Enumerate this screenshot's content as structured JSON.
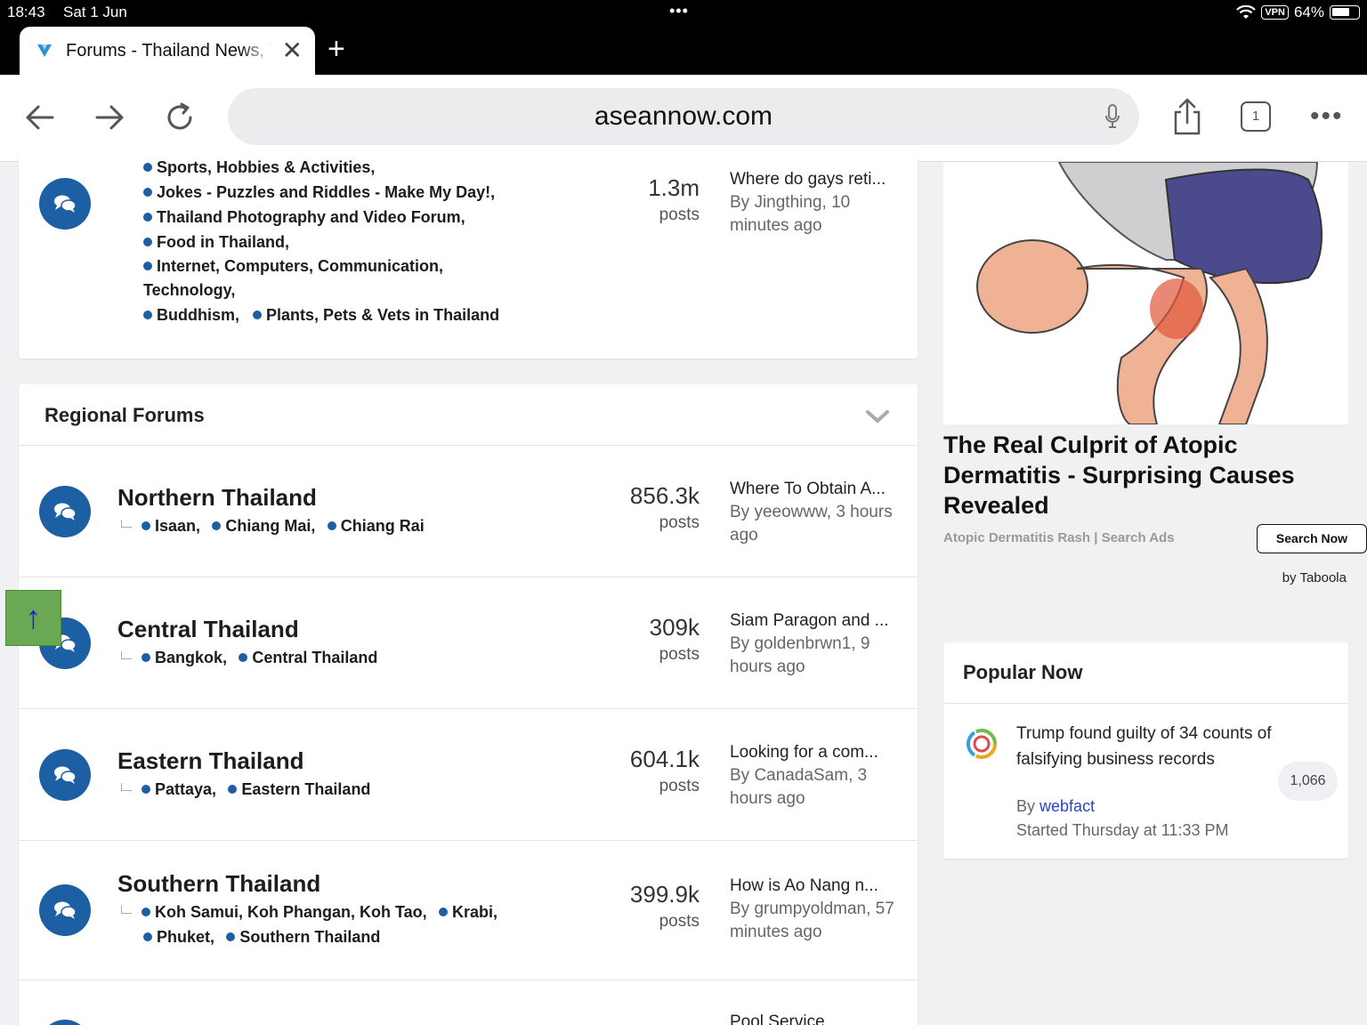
{
  "status": {
    "time": "18:43",
    "date": "Sat 1 Jun",
    "vpn": "VPN",
    "battery": "64%"
  },
  "browser": {
    "tab_title": "Forums - Thailand News, Travel",
    "url": "aseannow.com",
    "tab_count": "1"
  },
  "top_forum": {
    "subforums_line1": [
      "Sports, Hobbies & Activities,"
    ],
    "subforums_line2": [
      "Jokes - Puzzles and Riddles - Make My Day!,"
    ],
    "subforums_line3": [
      "Thailand Photography and Video Forum,"
    ],
    "subforums_line4": [
      "Food in Thailand,"
    ],
    "subforums_line5": "Internet, Computers, Communication,",
    "subforums_line5b": "Technology,",
    "subforums_line6": [
      "Buddhism,",
      "Plants, Pets & Vets in Thailand"
    ],
    "count": "1.3m",
    "count_label": "posts",
    "last_title": "Where do gays reti...",
    "last_by": "By Jingthing, 10",
    "last_time": "minutes ago"
  },
  "regional": {
    "heading": "Regional Forums",
    "forums": [
      {
        "name": "Northern Thailand",
        "subs": [
          "Isaan,",
          "Chiang Mai,",
          "Chiang Rai"
        ],
        "count": "856.3k",
        "count_label": "posts",
        "last_title": "Where To Obtain A...",
        "last_by": "By yeeowww, 3 hours",
        "last_time": "ago"
      },
      {
        "name": "Central Thailand",
        "subs": [
          "Bangkok,",
          "Central Thailand"
        ],
        "count": "309k",
        "count_label": "posts",
        "last_title": "Siam Paragon and ...",
        "last_by": "By goldenbrwn1, 9",
        "last_time": "hours ago"
      },
      {
        "name": "Eastern Thailand",
        "subs": [
          "Pattaya,",
          "Eastern Thailand"
        ],
        "count": "604.1k",
        "count_label": "posts",
        "last_title": "Looking for a com...",
        "last_by": "By CanadaSam, 3",
        "last_time": "hours ago"
      },
      {
        "name": "Southern Thailand",
        "subs": [
          "Koh Samui, Koh Phangan, Koh Tao,",
          "Krabi,"
        ],
        "subs2": [
          "Phuket,",
          "Southern Thailand"
        ],
        "count": "399.9k",
        "count_label": "posts",
        "last_title": "How is Ao Nang n...",
        "last_by": "By grumpyoldman, 57",
        "last_time": "minutes ago"
      },
      {
        "last_title": "Pool Service"
      }
    ]
  },
  "scroll_top": "↑",
  "ad": {
    "title": "The Real Culprit of Atopic Dermatitis - Surprising Causes Revealed",
    "source": "Atopic Dermatitis Rash | Search Ads",
    "button": "Search Now",
    "provider": "by Taboola"
  },
  "popular": {
    "heading": "Popular Now",
    "title": "Trump found guilty of 34 counts of falsifying business records",
    "by_prefix": "By",
    "author": "webfact",
    "started": "Started Thursday at 11:33 PM",
    "replies": "1,066"
  },
  "colors": {
    "accent": "#1d5fa3",
    "scroll_button": "#6ba854",
    "link": "#2a3fd0"
  }
}
